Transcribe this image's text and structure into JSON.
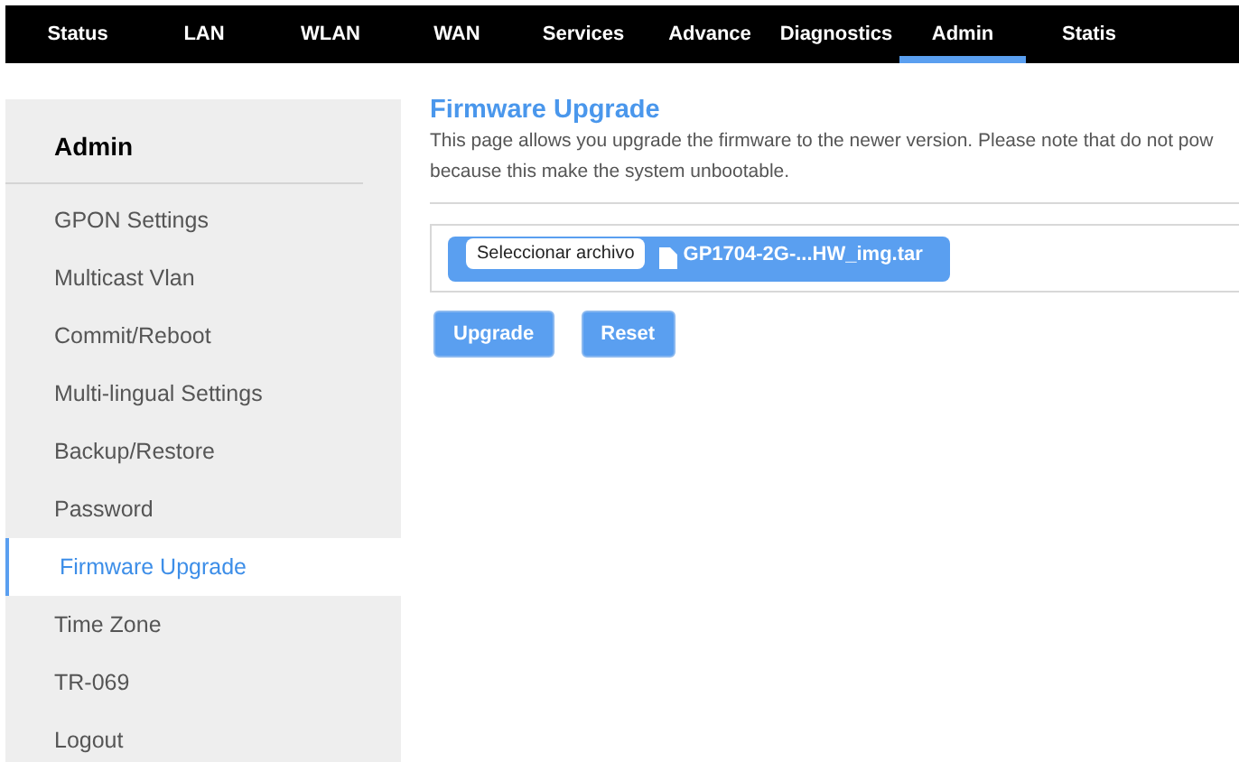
{
  "nav": [
    {
      "label": "Status",
      "selected": false
    },
    {
      "label": "LAN",
      "selected": false
    },
    {
      "label": "WLAN",
      "selected": false
    },
    {
      "label": "WAN",
      "selected": false
    },
    {
      "label": "Services",
      "selected": false
    },
    {
      "label": "Advance",
      "selected": false
    },
    {
      "label": "Diagnostics",
      "selected": false
    },
    {
      "label": "Admin",
      "selected": true
    },
    {
      "label": "Statis",
      "selected": false
    }
  ],
  "sidebar": {
    "title": "Admin",
    "items": [
      {
        "label": "GPON Settings",
        "selected": false
      },
      {
        "label": "Multicast Vlan",
        "selected": false
      },
      {
        "label": "Commit/Reboot",
        "selected": false
      },
      {
        "label": "Multi-lingual Settings",
        "selected": false
      },
      {
        "label": "Backup/Restore",
        "selected": false
      },
      {
        "label": "Password",
        "selected": false
      },
      {
        "label": "Firmware Upgrade",
        "selected": true
      },
      {
        "label": "Time Zone",
        "selected": false
      },
      {
        "label": "TR-069",
        "selected": false
      },
      {
        "label": "Logout",
        "selected": false
      }
    ]
  },
  "content": {
    "title": "Firmware Upgrade",
    "description": [
      "This page allows you upgrade the firmware to the newer version. Please note that do not pow",
      "because this make the system unbootable."
    ],
    "file_picker": {
      "button": "Seleccionar archivo",
      "file_name": "GP1704-2G-...HW_img.tar"
    },
    "buttons": [
      "Upgrade",
      "Reset"
    ]
  }
}
